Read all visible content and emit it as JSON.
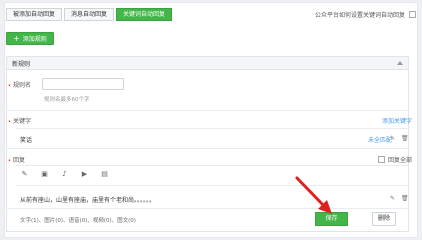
{
  "tabs": [
    {
      "label": "被添加自动回复"
    },
    {
      "label": "消息自动回复"
    },
    {
      "label": "关键词自动回复"
    }
  ],
  "top_option": {
    "label": "公众平台如何设置关键词自动回复"
  },
  "add_rule": {
    "label": "添加规则",
    "icon": "plus-icon"
  },
  "rule": {
    "title": "新规则",
    "name_label": "规则名",
    "name_value": "",
    "name_hint": "规则名最多60个字",
    "keyword_label": "关键字",
    "keyword_add": "添加关键字",
    "keyword_item": "笑话",
    "keyword_match": "未全匹配",
    "reply_label": "回复",
    "reply_all": "回复全部",
    "reply_text": "从前有座山，山里有座庙，庙里有个老和尚。。。。。。",
    "footer_stats": "文字(1)、图片(0)、语音(0)、视频(0)、图文(0)"
  },
  "buttons": {
    "save": "保存",
    "delete": "删除"
  },
  "toolbar_icons": [
    "pencil-icon",
    "image-icon",
    "microphone-icon",
    "video-icon",
    "article-icon"
  ],
  "colors": {
    "accent": "#44b549",
    "link": "#459ae9",
    "annotation": "#e02020"
  }
}
